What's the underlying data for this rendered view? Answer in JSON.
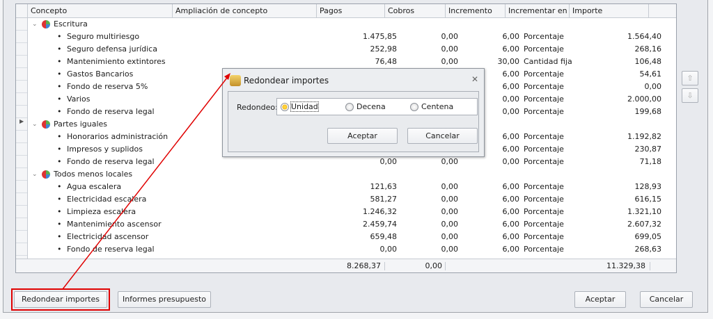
{
  "columns": [
    "Concepto",
    "Ampliación de concepto",
    "Pagos",
    "Cobros",
    "Incremento",
    "Incrementar en",
    "Importe"
  ],
  "groups": [
    {
      "name": "Escritura",
      "items": [
        {
          "concepto": "Seguro multiriesgo",
          "pagos": "1.475,85",
          "cobros": "0,00",
          "incremento": "6,00",
          "en": "Porcentaje",
          "importe": "1.564,40"
        },
        {
          "concepto": "Seguro defensa jurídica",
          "pagos": "252,98",
          "cobros": "0,00",
          "incremento": "6,00",
          "en": "Porcentaje",
          "importe": "268,16"
        },
        {
          "concepto": "Mantenimiento extintores",
          "pagos": "76,48",
          "cobros": "0,00",
          "incremento": "30,00",
          "en": "Cantidad fija",
          "importe": "106,48"
        },
        {
          "concepto": "Gastos Bancarios",
          "pagos": "",
          "cobros": "",
          "incremento": "6,00",
          "en": "Porcentaje",
          "importe": "54,61"
        },
        {
          "concepto": "Fondo de reserva 5%",
          "pagos": "",
          "cobros": "",
          "incremento": "6,00",
          "en": "Porcentaje",
          "importe": "0,00"
        },
        {
          "concepto": "Varios",
          "pagos": "",
          "cobros": "",
          "incremento": "0,00",
          "en": "Porcentaje",
          "importe": "2.000,00"
        },
        {
          "concepto": "Fondo de reserva legal",
          "pagos": "",
          "cobros": "",
          "incremento": "0,00",
          "en": "Porcentaje",
          "importe": "199,68"
        }
      ]
    },
    {
      "name": "Partes iguales",
      "items": [
        {
          "concepto": "Honorarios administración",
          "pagos": "",
          "cobros": "",
          "incremento": "6,00",
          "en": "Porcentaje",
          "importe": "1.192,82"
        },
        {
          "concepto": "Impresos y suplidos",
          "pagos": "",
          "cobros": "",
          "incremento": "6,00",
          "en": "Porcentaje",
          "importe": "230,87"
        },
        {
          "concepto": "Fondo de reserva legal",
          "pagos": "0,00",
          "cobros": "0,00",
          "incremento": "0,00",
          "en": "Porcentaje",
          "importe": "71,18"
        }
      ]
    },
    {
      "name": "Todos menos locales",
      "items": [
        {
          "concepto": "Agua escalera",
          "pagos": "121,63",
          "cobros": "0,00",
          "incremento": "6,00",
          "en": "Porcentaje",
          "importe": "128,93"
        },
        {
          "concepto": "Electricidad escalera",
          "pagos": "581,27",
          "cobros": "0,00",
          "incremento": "6,00",
          "en": "Porcentaje",
          "importe": "616,15"
        },
        {
          "concepto": "Limpieza escalera",
          "pagos": "1.246,32",
          "cobros": "0,00",
          "incremento": "6,00",
          "en": "Porcentaje",
          "importe": "1.321,10"
        },
        {
          "concepto": "Mantenimiento ascensor",
          "pagos": "2.459,74",
          "cobros": "0,00",
          "incremento": "6,00",
          "en": "Porcentaje",
          "importe": "2.607,32"
        },
        {
          "concepto": "Electricidad ascensor",
          "pagos": "659,48",
          "cobros": "0,00",
          "incremento": "6,00",
          "en": "Porcentaje",
          "importe": "699,05"
        },
        {
          "concepto": "Fondo de reserva legal",
          "pagos": "0,00",
          "cobros": "0,00",
          "incremento": "6,00",
          "en": "Porcentaje",
          "importe": "268,63"
        }
      ]
    }
  ],
  "totals": {
    "pagos": "8.268,37",
    "cobros": "0,00",
    "importe": "11.329,38"
  },
  "buttons": {
    "round": "Redondear importes",
    "reports": "Informes presupuesto",
    "accept": "Aceptar",
    "cancel": "Cancelar"
  },
  "dialog": {
    "title": "Redondear importes",
    "label": "Redondeo:",
    "options": [
      "Unidad",
      "Decena",
      "Centena"
    ],
    "selected": "Unidad",
    "accept": "Aceptar",
    "cancel": "Cancelar"
  },
  "colors": {
    "highlight": "#e00000"
  }
}
